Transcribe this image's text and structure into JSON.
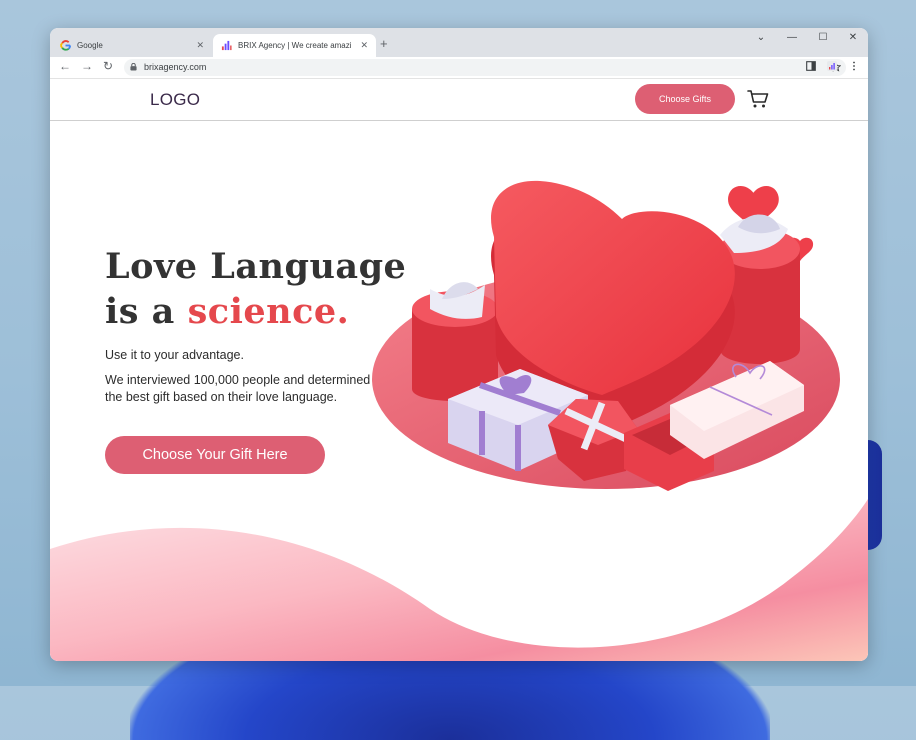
{
  "browser": {
    "tabs": [
      {
        "title": "Google",
        "active": false,
        "favicon": "google-g-icon"
      },
      {
        "title": "BRIX Agency | We create amazi",
        "active": true,
        "favicon": "brix-bars-icon"
      }
    ],
    "new_tab": "+",
    "url": "brixagency.com",
    "controls": {
      "tab_menu": "⌄",
      "minimize": "—",
      "maximize": "☐",
      "close": "✕"
    },
    "nav": {
      "back": "←",
      "forward": "→",
      "reload": "↻"
    }
  },
  "site": {
    "logo": "LOGO",
    "header_button": "Choose Gifts",
    "hero": {
      "line1": "Love Language",
      "line2_prefix": "is a ",
      "line2_accent": "science",
      "line2_suffix": ".",
      "subtitle": "Use it to your advantage.",
      "body": "We interviewed 100,000 people and determined the best gift based on their love language.",
      "cta": "Choose Your Gift Here"
    }
  },
  "colors": {
    "accent": "#dd5f73",
    "headline_accent": "#e5484d",
    "heart": "#f0474e",
    "wave_pink": "#f5a0b0"
  }
}
